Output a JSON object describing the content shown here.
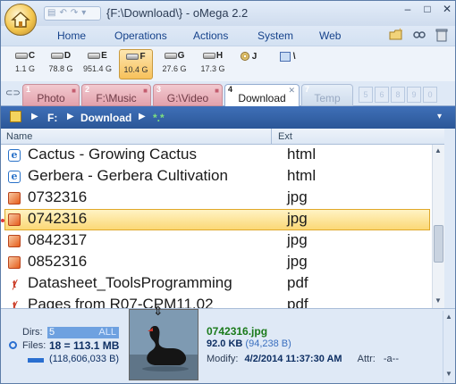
{
  "window": {
    "title": "{F:\\Download\\} - oMega 2.2"
  },
  "menu": {
    "items": [
      "Home",
      "Operations",
      "Actions",
      "System",
      "Web"
    ]
  },
  "drives": [
    {
      "letter": "C",
      "size": "1.1 G"
    },
    {
      "letter": "D",
      "size": "78.8 G"
    },
    {
      "letter": "E",
      "size": "951.4 G"
    },
    {
      "letter": "F",
      "size": "10.4 G",
      "active": true
    },
    {
      "letter": "G",
      "size": "27.6 G"
    },
    {
      "letter": "H",
      "size": "17.3 G"
    }
  ],
  "drive_extra": {
    "j": "J",
    "net": "\\"
  },
  "tabs": [
    {
      "num": "1",
      "label": "Photo"
    },
    {
      "num": "2",
      "label": "F:\\Music"
    },
    {
      "num": "3",
      "label": "G:\\Video"
    },
    {
      "num": "4",
      "label": "Download",
      "current": true
    },
    {
      "num": "7",
      "label": "Temp"
    }
  ],
  "tab_slots": [
    "5",
    "6",
    "8",
    "9",
    "0"
  ],
  "path": {
    "drive": "F:",
    "folder": "Download",
    "filter": "*.*"
  },
  "columns": {
    "name": "Name",
    "ext": "Ext"
  },
  "files": [
    {
      "name": "Cactus - Growing Cactus",
      "ext": "html",
      "icon": "ie-icon"
    },
    {
      "name": "Gerbera - Gerbera Cultivation",
      "ext": "html",
      "icon": "ie-icon"
    },
    {
      "name": "0732316",
      "ext": "jpg",
      "icon": "image-icon"
    },
    {
      "name": "0742316",
      "ext": "jpg",
      "icon": "image-icon",
      "selected": true
    },
    {
      "name": "0842317",
      "ext": "jpg",
      "icon": "image-icon"
    },
    {
      "name": "0852316",
      "ext": "jpg",
      "icon": "image-icon"
    },
    {
      "name": "Datasheet_ToolsProgramming",
      "ext": "pdf",
      "icon": "pdf-icon"
    },
    {
      "name": "Pages from R07-CPM11.02",
      "ext": "pdf",
      "icon": "pdf-icon"
    }
  ],
  "status": {
    "dirs_label": "Dirs:",
    "dirs_count": "5",
    "dirs_all": "ALL",
    "files_label": "Files:",
    "files_value": "18 = 113.1 MB",
    "bytes_value": "(118,606,033 B)",
    "selected_name": "0742316.jpg",
    "selected_size": "92.0 KB",
    "selected_bytes": "(94,238 B)",
    "modify_label": "Modify:",
    "modify_value": "4/2/2014 11:37:30 AM",
    "attr_label": "Attr:",
    "attr_value": "-a--"
  },
  "colors": {
    "accent": "#2b5797",
    "selection": "#fbd876"
  }
}
